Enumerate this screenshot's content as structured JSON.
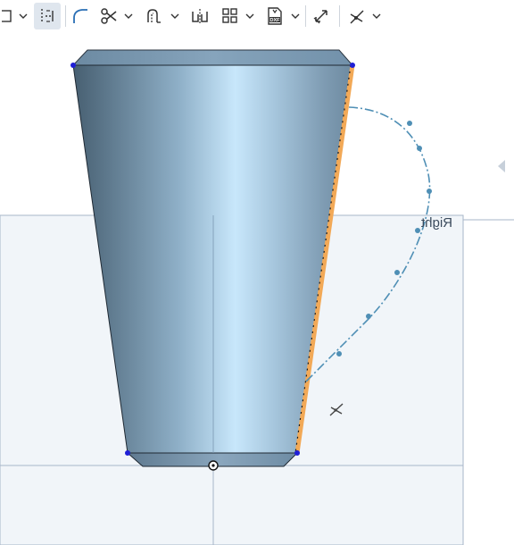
{
  "toolbar": {
    "tools": [
      {
        "name": "rectangle-tool",
        "icon": "rectangle-icon",
        "has_menu": true
      },
      {
        "name": "construction-tool",
        "icon": "construction-icon",
        "active": true
      },
      {
        "name": "fillet-tool",
        "icon": "fillet-arc-icon"
      },
      {
        "name": "trim-tool",
        "icon": "scissors-icon",
        "has_menu": true
      },
      {
        "name": "offset-tool",
        "icon": "offset-icon",
        "has_menu": true
      },
      {
        "name": "mirror-tool",
        "icon": "mirror-icon"
      },
      {
        "name": "pattern-tool",
        "icon": "grid-pattern-icon",
        "has_menu": true
      },
      {
        "name": "dxf-import-tool",
        "icon": "dxf-icon",
        "label": "DXF",
        "has_menu": true
      },
      {
        "name": "dimension-tool",
        "icon": "dimension-icon"
      },
      {
        "name": "constraint-tool",
        "icon": "constraint-icon",
        "has_menu": true
      }
    ]
  },
  "viewport": {
    "plane_label": "Right",
    "colors": {
      "body_dark": "#4a6478",
      "body_light": "#c9e6fa",
      "top_face": "#7895ad",
      "plane_fill": "#f1f5f9",
      "plane_edge": "#a7b6c9",
      "selected_edge": "#f2a957",
      "handle_curve": "#4f8fb5",
      "vertex": "#1f1fd6"
    }
  }
}
